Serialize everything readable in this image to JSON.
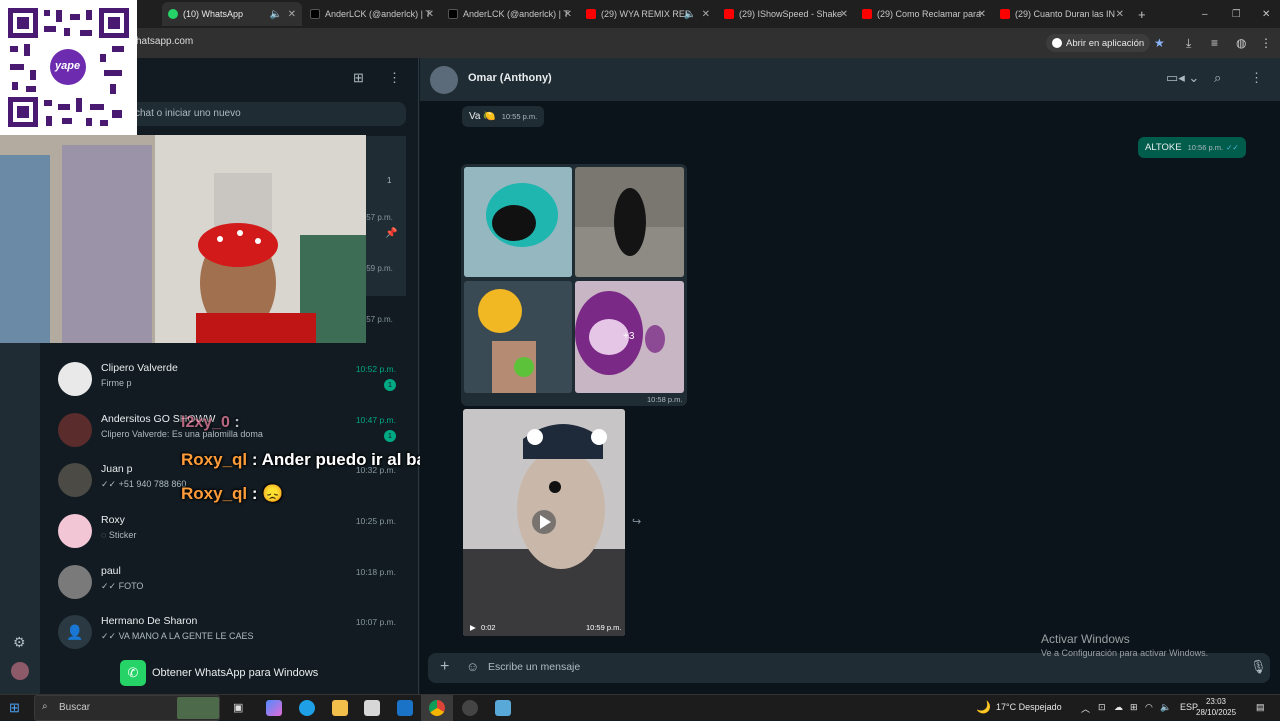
{
  "browser": {
    "tabs": [
      {
        "label": "(10) WhatsApp",
        "active": true
      },
      {
        "label": "AnderLCK (@anderlck) | T"
      },
      {
        "label": "AnderLCK (@anderlck) | T"
      },
      {
        "label": "(29) WYA REMIX RED"
      },
      {
        "label": "(29) IShowSpeed - Shake"
      },
      {
        "label": "(29) Como Reclamar para"
      },
      {
        "label": "(29) Cuanto Duran las IN"
      }
    ],
    "url": "hatsapp.com",
    "open_app_label": "Abrir en aplicación"
  },
  "qr": {
    "brand": "yape"
  },
  "sidebar": {
    "search_placeholder": "chat o iniciar uno nuevo",
    "partial_items": [
      {
        "count": "1",
        "time": ":57 p.m."
      },
      {
        "time": ":59 p.m."
      },
      {
        "time": ":57 p.m."
      }
    ],
    "chats": [
      {
        "name": "Clipero Valverde",
        "message": "Firme p",
        "time": "10:52 p.m.",
        "unread": "1",
        "time_green": true
      },
      {
        "name": "Andersitos GO SHOWW",
        "message": "Clipero Valverde: Es una palomilla doma",
        "time": "10:47 p.m.",
        "unread": "1",
        "time_green": true
      },
      {
        "name": "Juan p",
        "message": "✓✓ +51 940 788 860",
        "time": "10:32 p.m."
      },
      {
        "name": "Roxy",
        "message": "Sticker",
        "time": "10:25 p.m."
      },
      {
        "name": "paul",
        "message": "✓✓ FOTO",
        "time": "10:18 p.m."
      },
      {
        "name": "Hermano De Sharon",
        "message": "✓✓ VA MANO A LA GENTE LE CAES",
        "time": "10:07 p.m."
      }
    ],
    "get_windows_label": "Obtener WhatsApp para Windows"
  },
  "stream_chat": [
    {
      "user": "l2xy_0",
      "text": ":"
    },
    {
      "user": "Roxy_ql",
      "text": ": Ander puedo ir al baño?"
    },
    {
      "user": "Roxy_ql",
      "text": ": 😞"
    }
  ],
  "conversation": {
    "contact_name": "Omar (Anthony)",
    "messages": {
      "first_in": {
        "text": "Va 🍋",
        "time": "10:55 p.m."
      },
      "first_out": {
        "text": "ALTOKE",
        "time": "10:56 p.m."
      },
      "album": {
        "more": "+3",
        "time": "10:58 p.m."
      },
      "video": {
        "duration": "0:02",
        "time": "10:59 p.m."
      }
    },
    "composer_placeholder": "Escribe un mensaje"
  },
  "windows_activation": {
    "title": "Activar Windows",
    "subtitle": "Ve a Configuración para activar Windows."
  },
  "taskbar": {
    "search_label": "Buscar",
    "weather": "17°C Despejado",
    "language": "ESP",
    "time": "23:03",
    "date": "28/10/2025"
  },
  "colors": {
    "whatsapp_green": "#00a884",
    "panel_bg": "#111b21",
    "header_bg": "#202c33",
    "outgoing_bubble": "#005c4b"
  }
}
